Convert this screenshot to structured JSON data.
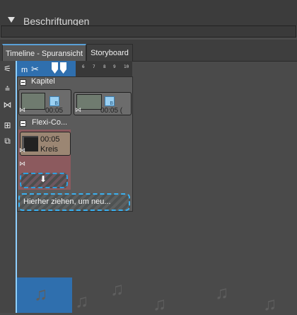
{
  "section": {
    "title": "Beschriftungen"
  },
  "tabs": [
    {
      "label": "Timeline - Spuransicht",
      "active": true
    },
    {
      "label": "Storyboard",
      "active": false
    }
  ],
  "ruler": {
    "marker_text": "m",
    "ticks": [
      "6",
      "7",
      "8",
      "9",
      "10"
    ]
  },
  "chapter": {
    "label": "Kapitel",
    "clip1_time": "00:05",
    "clip2_time": "00:05 ("
  },
  "flexi": {
    "label": "Flexi-Co...",
    "clip_time": "00:05",
    "clip_name": "Kreis"
  },
  "drop": {
    "arrow": "⬇",
    "hint": "Hierher ziehen, um neu..."
  },
  "colors": {
    "accent": "#2f6fae",
    "playhead": "#8fd0ff",
    "flexi_bg": "#8c5a5e",
    "drop_border": "#3ab0f0"
  }
}
